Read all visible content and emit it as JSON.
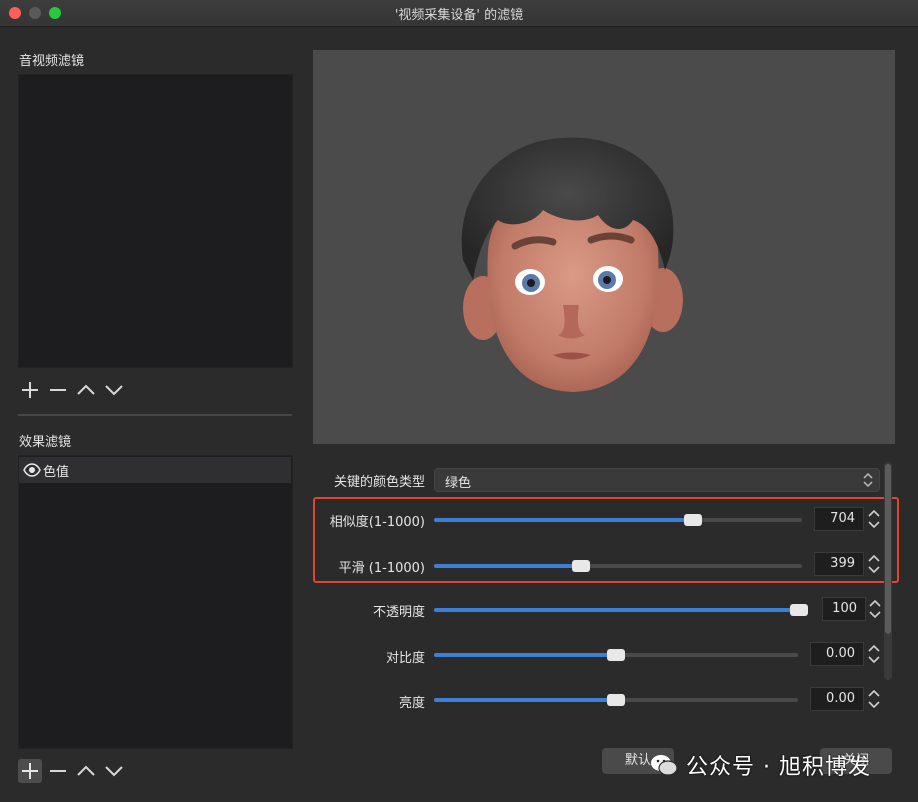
{
  "window": {
    "title": "'视频采集设备' 的滤镜"
  },
  "left": {
    "av_filters_label": "音视频滤镜",
    "effect_filters_label": "效果滤镜",
    "effect_items": [
      {
        "name": "色值",
        "visible": true
      }
    ],
    "toolbar_icons": [
      "plus-icon",
      "minus-icon",
      "chevron-up-icon",
      "chevron-down-icon"
    ]
  },
  "properties": {
    "key_color_type": {
      "label": "关键的颜色类型",
      "value": "绿色"
    },
    "sliders": [
      {
        "label": "相似度(1-1000)",
        "value": "704",
        "fraction": 0.704
      },
      {
        "label": "平滑 (1-1000)",
        "value": "399",
        "fraction": 0.399
      },
      {
        "label": "不透明度",
        "value": "100",
        "fraction": 1.0
      },
      {
        "label": "对比度",
        "value": "0.00",
        "fraction": 0.5
      },
      {
        "label": "亮度",
        "value": "0.00",
        "fraction": 0.5
      }
    ]
  },
  "buttons": {
    "defaults": "默认",
    "close": "关闭"
  },
  "watermark": {
    "text": "公众号 · 旭积博发"
  },
  "colors": {
    "accent": "#3c80d6",
    "highlight": "#e2452f",
    "background": "#2b2b2b"
  }
}
